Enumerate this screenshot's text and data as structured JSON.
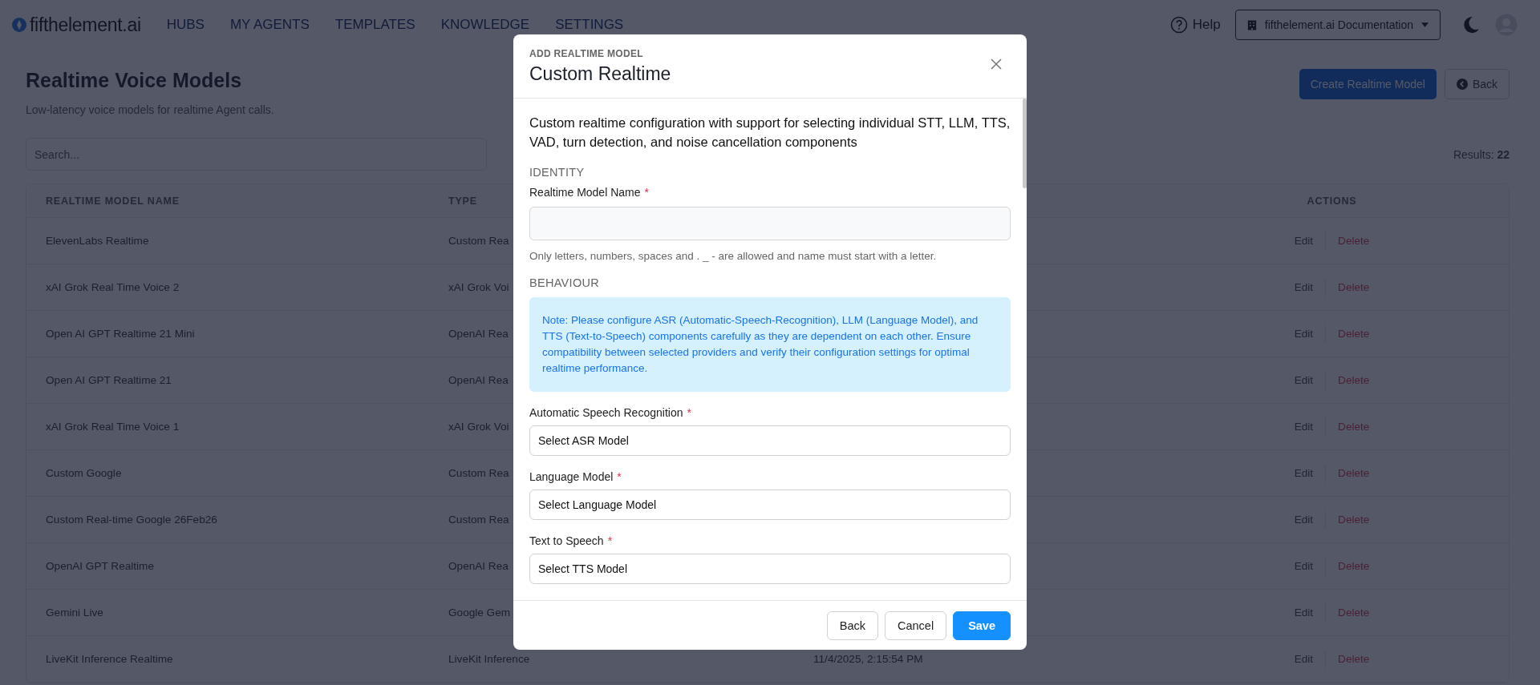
{
  "header": {
    "brand": "fifthelement.ai",
    "nav": [
      "HUBS",
      "MY AGENTS",
      "TEMPLATES",
      "KNOWLEDGE",
      "SETTINGS"
    ],
    "help": "Help",
    "workspace": "fifthelement.ai Documentation"
  },
  "page": {
    "title": "Realtime Voice Models",
    "subtitle": "Low-latency voice models for realtime Agent calls.",
    "create_button": "Create Realtime Model",
    "back_button": "Back",
    "search": {
      "placeholder": "Search..."
    },
    "results": "Results: **22**"
  },
  "table": {
    "columns": {
      "name": "REALTIME MODEL NAME",
      "type": "TYPE",
      "actions": "ACTIONS"
    },
    "rows": [
      {
        "name": "ElevenLabs Realtime",
        "type": "Custom Rea",
        "edit": "Edit",
        "delete": "Delete"
      },
      {
        "name": "xAI Grok Real Time Voice 2",
        "type": "xAI Grok Voi",
        "edit": "Edit",
        "delete": "Delete"
      },
      {
        "name": "Open AI GPT Realtime 21 Mini",
        "type": "OpenAI Rea",
        "edit": "Edit",
        "delete": "Delete"
      },
      {
        "name": "Open AI GPT Realtime 21",
        "type": "OpenAI Rea",
        "edit": "Edit",
        "delete": "Delete"
      },
      {
        "name": "xAI Grok Real Time Voice 1",
        "type": "xAI Grok Voi",
        "edit": "Edit",
        "delete": "Delete"
      },
      {
        "name": "Custom Google",
        "type": "Custom Rea",
        "edit": "Edit",
        "delete": "Delete"
      },
      {
        "name": "Custom Real-time Google 26Feb26",
        "type": "Custom Rea",
        "edit": "Edit",
        "delete": "Delete"
      },
      {
        "name": "OpenAI GPT Realtime",
        "type": "OpenAI Rea",
        "edit": "Edit",
        "delete": "Delete"
      },
      {
        "name": "Gemini Live",
        "type": "Google Gem",
        "edit": "Edit",
        "delete": "Delete"
      },
      {
        "name": "LiveKit Inference Realtime",
        "type": "LiveKit Inference",
        "column_3": "11/4/2025, 2:15:54 PM",
        "edit": "Edit",
        "delete": "Delete"
      }
    ]
  },
  "modal": {
    "eyebrow": "ADD REALTIME MODEL",
    "title": "Custom Realtime",
    "description": "Custom realtime configuration with support for selecting individual STT, LLM, TTS, VAD, turn detection, and noise cancellation components",
    "sections": [
      {
        "heading": "IDENTITY",
        "fields": [
          {
            "kind": "text",
            "label": "Realtime Model Name",
            "mark": "*",
            "hint": "Only letters, numbers, spaces and . _ - are allowed and name must start with a letter."
          }
        ]
      },
      {
        "heading": "BEHAVIOUR",
        "note": "Note: Please configure ASR (Automatic-Speech-Recognition), LLM (Language Model), and TTS (Text-to-Speech) components carefully as they are dependent on each other. Ensure compatibility between selected providers and verify their configuration settings for optimal realtime performance.",
        "fields": [
          {
            "kind": "select",
            "label": "Automatic Speech Recognition",
            "mark": "*",
            "value": "Select ASR Model"
          },
          {
            "kind": "select",
            "label": "Language Model",
            "mark": "*",
            "value": "Select Language Model"
          },
          {
            "kind": "select",
            "label": "Text to Speech",
            "mark": "*",
            "value": "Select TTS Model"
          }
        ]
      }
    ],
    "buttons": [
      {
        "label": "Back",
        "kind": "secondary"
      },
      {
        "label": "Cancel",
        "kind": "secondary"
      },
      {
        "label": "Save",
        "kind": "primary"
      }
    ]
  }
}
